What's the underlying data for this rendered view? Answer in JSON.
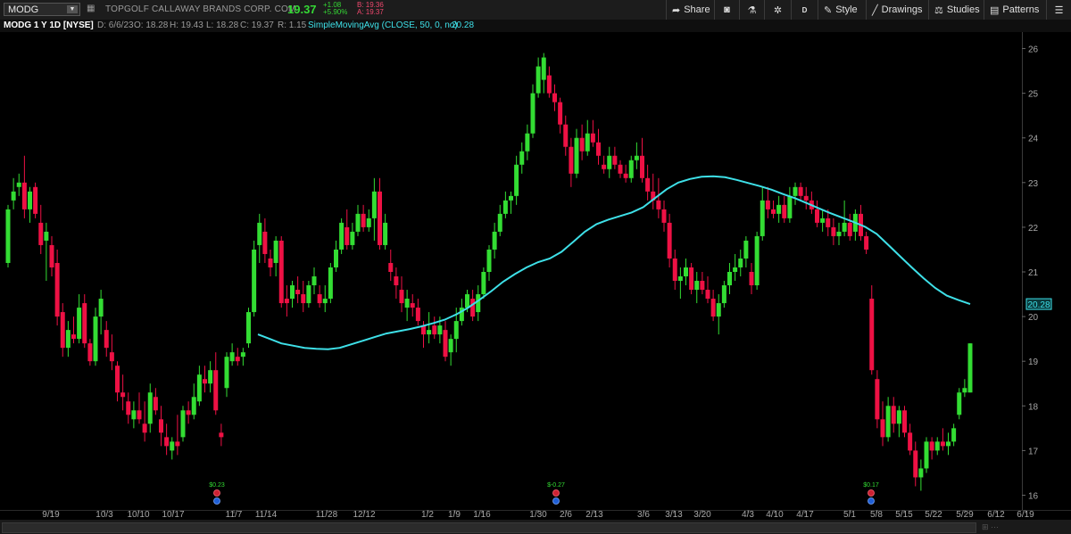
{
  "toolbar": {
    "symbol": "MODG",
    "company": "TOPGOLF CALLAWAY BRANDS CORP. COM",
    "last": "19.37",
    "change": "+1.08",
    "change_pct": "+5.90%",
    "bid": "B: 19.36",
    "ask": "A: 19.37",
    "share": "Share",
    "period_btn": "D",
    "style": "Style",
    "drawings": "Drawings",
    "studies": "Studies",
    "patterns": "Patterns"
  },
  "info": {
    "title": "MODG 1 Y 1D [NYSE]",
    "date": "D: 6/6/23",
    "open": "O: 18.28",
    "high": "H: 19.43",
    "low": "L: 18.28",
    "close": "C: 19.37",
    "range": "R: 1.15",
    "study": "SimpleMovingAvg (CLOSE, 50, 0, no)",
    "study_value": "20.28"
  },
  "colors": {
    "up": "#33dd33",
    "down": "#ee1144",
    "sma": "#3ee0e8",
    "bg": "#000000"
  },
  "chart_data": {
    "type": "candlestick",
    "y_ticks": [
      16,
      17,
      18,
      19,
      20,
      21,
      22,
      23,
      24,
      25,
      26
    ],
    "ylim": [
      15.7,
      26.7
    ],
    "x_ticks": [
      "9/19",
      "10/3",
      "10/10",
      "10/17",
      "11/7",
      "11/14",
      "11/28",
      "12/12",
      "1/2",
      "1/9",
      "1/16",
      "1/30",
      "2/6",
      "2/13",
      "3/6",
      "3/13",
      "3/20",
      "4/3",
      "4/10",
      "4/17",
      "5/1",
      "5/8",
      "5/15",
      "5/22",
      "5/29",
      "6/12",
      "6/19"
    ],
    "sma_label": "20.28",
    "earnings": [
      {
        "date": "11/3",
        "label": "$0.23"
      },
      {
        "date": "2/9",
        "label": "$-0.27"
      },
      {
        "date": "5/4",
        "label": "$0.17"
      }
    ],
    "candles": [
      {
        "o": 21.2,
        "h": 22.5,
        "l": 21.1,
        "c": 22.4
      },
      {
        "o": 22.6,
        "h": 23.1,
        "l": 22.4,
        "c": 22.8
      },
      {
        "o": 22.9,
        "h": 23.2,
        "l": 22.7,
        "c": 23.0
      },
      {
        "o": 23.0,
        "h": 23.6,
        "l": 22.2,
        "c": 22.4
      },
      {
        "o": 22.4,
        "h": 22.9,
        "l": 22.1,
        "c": 22.8
      },
      {
        "o": 22.9,
        "h": 23.0,
        "l": 22.2,
        "c": 22.3
      },
      {
        "o": 22.1,
        "h": 22.5,
        "l": 21.4,
        "c": 21.6
      },
      {
        "o": 21.7,
        "h": 22.1,
        "l": 20.8,
        "c": 21.9
      },
      {
        "o": 21.6,
        "h": 21.8,
        "l": 20.9,
        "c": 21.1
      },
      {
        "o": 21.2,
        "h": 21.5,
        "l": 19.8,
        "c": 20.0
      },
      {
        "o": 20.1,
        "h": 20.3,
        "l": 19.1,
        "c": 19.3
      },
      {
        "o": 19.3,
        "h": 19.9,
        "l": 19.1,
        "c": 19.7
      },
      {
        "o": 19.6,
        "h": 20.0,
        "l": 19.4,
        "c": 19.5
      },
      {
        "o": 19.5,
        "h": 20.5,
        "l": 19.4,
        "c": 20.2
      },
      {
        "o": 20.3,
        "h": 20.5,
        "l": 19.3,
        "c": 19.4
      },
      {
        "o": 19.4,
        "h": 19.5,
        "l": 18.9,
        "c": 19.0
      },
      {
        "o": 19.0,
        "h": 20.2,
        "l": 18.9,
        "c": 20.0
      },
      {
        "o": 20.0,
        "h": 20.6,
        "l": 19.6,
        "c": 20.4
      },
      {
        "o": 19.7,
        "h": 19.9,
        "l": 19.1,
        "c": 19.3
      },
      {
        "o": 19.2,
        "h": 19.6,
        "l": 18.8,
        "c": 19.0
      },
      {
        "o": 18.9,
        "h": 19.0,
        "l": 18.1,
        "c": 18.3
      },
      {
        "o": 18.3,
        "h": 18.7,
        "l": 17.9,
        "c": 18.2
      },
      {
        "o": 18.1,
        "h": 18.3,
        "l": 17.6,
        "c": 17.8
      },
      {
        "o": 17.7,
        "h": 18.1,
        "l": 17.5,
        "c": 17.9
      },
      {
        "o": 17.9,
        "h": 18.3,
        "l": 17.6,
        "c": 17.7
      },
      {
        "o": 17.6,
        "h": 18.1,
        "l": 17.2,
        "c": 17.4
      },
      {
        "o": 17.6,
        "h": 18.5,
        "l": 17.4,
        "c": 18.3
      },
      {
        "o": 18.2,
        "h": 18.4,
        "l": 17.8,
        "c": 17.9
      },
      {
        "o": 17.7,
        "h": 18.0,
        "l": 17.1,
        "c": 17.4
      },
      {
        "o": 17.3,
        "h": 17.6,
        "l": 16.9,
        "c": 17.1
      },
      {
        "o": 17.0,
        "h": 17.3,
        "l": 16.8,
        "c": 17.2
      },
      {
        "o": 17.2,
        "h": 17.8,
        "l": 16.9,
        "c": 17.1
      },
      {
        "o": 17.3,
        "h": 18.0,
        "l": 17.2,
        "c": 17.9
      },
      {
        "o": 17.9,
        "h": 18.1,
        "l": 17.6,
        "c": 17.8
      },
      {
        "o": 17.8,
        "h": 18.5,
        "l": 17.7,
        "c": 18.2
      },
      {
        "o": 18.1,
        "h": 18.9,
        "l": 18.0,
        "c": 18.7
      },
      {
        "o": 18.6,
        "h": 18.9,
        "l": 18.3,
        "c": 18.5
      },
      {
        "o": 18.5,
        "h": 19.0,
        "l": 18.3,
        "c": 18.8
      },
      {
        "o": 18.8,
        "h": 19.2,
        "l": 17.8,
        "c": 17.9
      },
      {
        "o": 17.4,
        "h": 17.6,
        "l": 17.1,
        "c": 17.3
      },
      {
        "o": 18.4,
        "h": 19.2,
        "l": 18.2,
        "c": 19.1
      },
      {
        "o": 19.0,
        "h": 19.4,
        "l": 18.9,
        "c": 19.2
      },
      {
        "o": 19.1,
        "h": 19.3,
        "l": 18.9,
        "c": 19.0
      },
      {
        "o": 19.1,
        "h": 19.3,
        "l": 18.9,
        "c": 19.2
      },
      {
        "o": 19.4,
        "h": 20.2,
        "l": 19.3,
        "c": 20.1
      },
      {
        "o": 20.1,
        "h": 21.7,
        "l": 20.0,
        "c": 21.5
      },
      {
        "o": 21.6,
        "h": 22.3,
        "l": 21.2,
        "c": 22.1
      },
      {
        "o": 21.9,
        "h": 22.2,
        "l": 21.2,
        "c": 21.4
      },
      {
        "o": 21.3,
        "h": 21.5,
        "l": 20.9,
        "c": 21.1
      },
      {
        "o": 21.2,
        "h": 21.8,
        "l": 20.9,
        "c": 21.7
      },
      {
        "o": 21.7,
        "h": 21.8,
        "l": 20.2,
        "c": 20.3
      },
      {
        "o": 20.4,
        "h": 20.7,
        "l": 20.0,
        "c": 20.3
      },
      {
        "o": 20.4,
        "h": 20.8,
        "l": 20.2,
        "c": 20.7
      },
      {
        "o": 20.6,
        "h": 20.9,
        "l": 20.3,
        "c": 20.5
      },
      {
        "o": 20.5,
        "h": 20.8,
        "l": 20.1,
        "c": 20.3
      },
      {
        "o": 20.3,
        "h": 20.8,
        "l": 20.2,
        "c": 20.7
      },
      {
        "o": 20.7,
        "h": 21.1,
        "l": 20.5,
        "c": 20.9
      },
      {
        "o": 20.5,
        "h": 20.7,
        "l": 20.2,
        "c": 20.3
      },
      {
        "o": 20.3,
        "h": 20.7,
        "l": 20.1,
        "c": 20.4
      },
      {
        "o": 20.4,
        "h": 21.2,
        "l": 20.3,
        "c": 21.1
      },
      {
        "o": 21.1,
        "h": 21.7,
        "l": 21.0,
        "c": 21.5
      },
      {
        "o": 21.5,
        "h": 22.2,
        "l": 21.4,
        "c": 22.1
      },
      {
        "o": 22.0,
        "h": 22.4,
        "l": 21.5,
        "c": 21.6
      },
      {
        "o": 21.6,
        "h": 22.1,
        "l": 21.5,
        "c": 21.9
      },
      {
        "o": 21.9,
        "h": 22.5,
        "l": 21.8,
        "c": 22.3
      },
      {
        "o": 22.3,
        "h": 22.5,
        "l": 21.9,
        "c": 22.0
      },
      {
        "o": 22.0,
        "h": 22.4,
        "l": 21.9,
        "c": 22.2
      },
      {
        "o": 22.2,
        "h": 23.1,
        "l": 21.7,
        "c": 22.8
      },
      {
        "o": 22.8,
        "h": 23.1,
        "l": 21.5,
        "c": 21.6
      },
      {
        "o": 21.6,
        "h": 22.3,
        "l": 21.5,
        "c": 22.1
      },
      {
        "o": 21.2,
        "h": 21.5,
        "l": 20.8,
        "c": 21.0
      },
      {
        "o": 20.9,
        "h": 21.1,
        "l": 20.4,
        "c": 20.7
      },
      {
        "o": 20.6,
        "h": 20.9,
        "l": 20.1,
        "c": 20.3
      },
      {
        "o": 20.2,
        "h": 20.6,
        "l": 19.9,
        "c": 20.4
      },
      {
        "o": 20.3,
        "h": 20.5,
        "l": 20.0,
        "c": 20.2
      },
      {
        "o": 20.2,
        "h": 20.4,
        "l": 19.8,
        "c": 19.9
      },
      {
        "o": 19.8,
        "h": 19.9,
        "l": 19.3,
        "c": 19.6
      },
      {
        "o": 19.6,
        "h": 20.1,
        "l": 19.4,
        "c": 19.7
      },
      {
        "o": 19.8,
        "h": 20.0,
        "l": 19.5,
        "c": 19.6
      },
      {
        "o": 19.6,
        "h": 20.0,
        "l": 19.4,
        "c": 19.8
      },
      {
        "o": 19.7,
        "h": 19.9,
        "l": 19.0,
        "c": 19.1
      },
      {
        "o": 19.2,
        "h": 19.6,
        "l": 18.9,
        "c": 19.5
      },
      {
        "o": 19.5,
        "h": 20.2,
        "l": 19.2,
        "c": 19.9
      },
      {
        "o": 19.9,
        "h": 20.4,
        "l": 19.8,
        "c": 20.2
      },
      {
        "o": 20.2,
        "h": 20.6,
        "l": 20.1,
        "c": 20.5
      },
      {
        "o": 20.4,
        "h": 20.6,
        "l": 19.9,
        "c": 20.0
      },
      {
        "o": 20.1,
        "h": 20.7,
        "l": 19.9,
        "c": 20.5
      },
      {
        "o": 20.5,
        "h": 21.1,
        "l": 20.4,
        "c": 21.0
      },
      {
        "o": 21.0,
        "h": 21.6,
        "l": 20.8,
        "c": 21.5
      },
      {
        "o": 21.5,
        "h": 22.1,
        "l": 21.3,
        "c": 21.9
      },
      {
        "o": 21.9,
        "h": 22.5,
        "l": 21.8,
        "c": 22.3
      },
      {
        "o": 22.3,
        "h": 22.8,
        "l": 22.2,
        "c": 22.6
      },
      {
        "o": 22.6,
        "h": 22.8,
        "l": 22.3,
        "c": 22.7
      },
      {
        "o": 22.7,
        "h": 23.6,
        "l": 22.5,
        "c": 23.4
      },
      {
        "o": 23.4,
        "h": 23.9,
        "l": 23.2,
        "c": 23.7
      },
      {
        "o": 23.7,
        "h": 24.3,
        "l": 23.5,
        "c": 24.1
      },
      {
        "o": 24.1,
        "h": 25.2,
        "l": 24.0,
        "c": 25.0
      },
      {
        "o": 25.0,
        "h": 25.8,
        "l": 24.9,
        "c": 25.6
      },
      {
        "o": 25.3,
        "h": 25.9,
        "l": 25.0,
        "c": 25.8
      },
      {
        "o": 25.4,
        "h": 25.6,
        "l": 24.9,
        "c": 25.0
      },
      {
        "o": 25.0,
        "h": 25.2,
        "l": 24.6,
        "c": 24.8
      },
      {
        "o": 24.8,
        "h": 24.9,
        "l": 24.1,
        "c": 24.3
      },
      {
        "o": 24.3,
        "h": 24.5,
        "l": 23.6,
        "c": 23.8
      },
      {
        "o": 23.8,
        "h": 24.0,
        "l": 22.9,
        "c": 23.2
      },
      {
        "o": 23.2,
        "h": 24.2,
        "l": 23.1,
        "c": 24.0
      },
      {
        "o": 24.0,
        "h": 24.3,
        "l": 23.5,
        "c": 23.7
      },
      {
        "o": 23.7,
        "h": 24.4,
        "l": 23.6,
        "c": 24.1
      },
      {
        "o": 24.1,
        "h": 24.4,
        "l": 23.8,
        "c": 23.9
      },
      {
        "o": 23.9,
        "h": 24.2,
        "l": 23.4,
        "c": 23.6
      },
      {
        "o": 23.4,
        "h": 23.6,
        "l": 23.2,
        "c": 23.3
      },
      {
        "o": 23.3,
        "h": 23.8,
        "l": 23.1,
        "c": 23.6
      },
      {
        "o": 23.6,
        "h": 23.8,
        "l": 23.3,
        "c": 23.4
      },
      {
        "o": 23.4,
        "h": 23.5,
        "l": 23.1,
        "c": 23.2
      },
      {
        "o": 23.2,
        "h": 23.4,
        "l": 23.0,
        "c": 23.1
      },
      {
        "o": 23.1,
        "h": 23.6,
        "l": 23.0,
        "c": 23.5
      },
      {
        "o": 23.5,
        "h": 23.9,
        "l": 23.3,
        "c": 23.6
      },
      {
        "o": 23.6,
        "h": 24.0,
        "l": 23.0,
        "c": 23.1
      },
      {
        "o": 23.1,
        "h": 23.4,
        "l": 22.6,
        "c": 22.8
      },
      {
        "o": 22.8,
        "h": 23.2,
        "l": 22.4,
        "c": 22.6
      },
      {
        "o": 22.6,
        "h": 23.1,
        "l": 22.2,
        "c": 22.4
      },
      {
        "o": 22.4,
        "h": 22.6,
        "l": 21.9,
        "c": 22.1
      },
      {
        "o": 22.1,
        "h": 22.3,
        "l": 21.1,
        "c": 21.3
      },
      {
        "o": 21.3,
        "h": 21.5,
        "l": 20.6,
        "c": 20.8
      },
      {
        "o": 20.8,
        "h": 21.1,
        "l": 20.4,
        "c": 20.9
      },
      {
        "o": 20.9,
        "h": 21.3,
        "l": 20.7,
        "c": 21.1
      },
      {
        "o": 21.1,
        "h": 21.2,
        "l": 20.5,
        "c": 20.6
      },
      {
        "o": 20.6,
        "h": 21.0,
        "l": 20.3,
        "c": 20.8
      },
      {
        "o": 20.8,
        "h": 21.0,
        "l": 20.5,
        "c": 20.6
      },
      {
        "o": 20.6,
        "h": 20.9,
        "l": 20.3,
        "c": 20.4
      },
      {
        "o": 20.4,
        "h": 20.6,
        "l": 19.9,
        "c": 20.0
      },
      {
        "o": 20.0,
        "h": 20.5,
        "l": 19.6,
        "c": 20.3
      },
      {
        "o": 20.3,
        "h": 20.8,
        "l": 20.2,
        "c": 20.7
      },
      {
        "o": 20.7,
        "h": 21.2,
        "l": 20.5,
        "c": 21.0
      },
      {
        "o": 21.0,
        "h": 21.4,
        "l": 20.8,
        "c": 21.1
      },
      {
        "o": 21.1,
        "h": 21.5,
        "l": 20.9,
        "c": 21.3
      },
      {
        "o": 21.3,
        "h": 21.8,
        "l": 21.1,
        "c": 21.7
      },
      {
        "o": 21.0,
        "h": 21.2,
        "l": 20.5,
        "c": 20.7
      },
      {
        "o": 20.7,
        "h": 21.9,
        "l": 20.6,
        "c": 21.8
      },
      {
        "o": 21.8,
        "h": 22.9,
        "l": 21.7,
        "c": 22.6
      },
      {
        "o": 22.6,
        "h": 22.9,
        "l": 22.2,
        "c": 22.4
      },
      {
        "o": 22.4,
        "h": 22.6,
        "l": 22.2,
        "c": 22.3
      },
      {
        "o": 22.3,
        "h": 22.7,
        "l": 22.1,
        "c": 22.5
      },
      {
        "o": 22.5,
        "h": 22.7,
        "l": 22.1,
        "c": 22.2
      },
      {
        "o": 22.2,
        "h": 22.9,
        "l": 22.1,
        "c": 22.7
      },
      {
        "o": 22.7,
        "h": 23.0,
        "l": 22.5,
        "c": 22.9
      },
      {
        "o": 22.9,
        "h": 23.0,
        "l": 22.6,
        "c": 22.7
      },
      {
        "o": 22.7,
        "h": 22.9,
        "l": 22.4,
        "c": 22.6
      },
      {
        "o": 22.6,
        "h": 22.8,
        "l": 22.3,
        "c": 22.4
      },
      {
        "o": 22.4,
        "h": 22.6,
        "l": 22.0,
        "c": 22.1
      },
      {
        "o": 22.1,
        "h": 22.4,
        "l": 21.9,
        "c": 22.2
      },
      {
        "o": 22.2,
        "h": 22.4,
        "l": 21.8,
        "c": 22.0
      },
      {
        "o": 22.0,
        "h": 22.2,
        "l": 21.6,
        "c": 21.8
      },
      {
        "o": 21.8,
        "h": 22.1,
        "l": 21.6,
        "c": 21.9
      },
      {
        "o": 21.9,
        "h": 22.6,
        "l": 21.8,
        "c": 22.1
      },
      {
        "o": 22.1,
        "h": 22.3,
        "l": 21.7,
        "c": 21.8
      },
      {
        "o": 21.9,
        "h": 22.4,
        "l": 21.7,
        "c": 22.3
      },
      {
        "o": 22.3,
        "h": 22.5,
        "l": 21.7,
        "c": 21.8
      },
      {
        "o": 21.8,
        "h": 21.9,
        "l": 21.4,
        "c": 21.5
      },
      {
        "o": 20.4,
        "h": 20.7,
        "l": 18.7,
        "c": 18.8
      },
      {
        "o": 18.6,
        "h": 18.8,
        "l": 17.5,
        "c": 17.7
      },
      {
        "o": 17.7,
        "h": 18.1,
        "l": 17.1,
        "c": 17.3
      },
      {
        "o": 17.3,
        "h": 18.2,
        "l": 17.2,
        "c": 18.0
      },
      {
        "o": 18.0,
        "h": 18.2,
        "l": 17.4,
        "c": 17.6
      },
      {
        "o": 17.6,
        "h": 18.0,
        "l": 17.3,
        "c": 17.9
      },
      {
        "o": 17.9,
        "h": 18.0,
        "l": 17.3,
        "c": 17.4
      },
      {
        "o": 17.4,
        "h": 17.6,
        "l": 16.9,
        "c": 17.0
      },
      {
        "o": 17.0,
        "h": 17.2,
        "l": 16.2,
        "c": 16.4
      },
      {
        "o": 16.4,
        "h": 16.8,
        "l": 16.1,
        "c": 16.6
      },
      {
        "o": 16.6,
        "h": 17.3,
        "l": 16.5,
        "c": 17.2
      },
      {
        "o": 17.2,
        "h": 17.3,
        "l": 16.8,
        "c": 17.0
      },
      {
        "o": 17.0,
        "h": 17.3,
        "l": 16.9,
        "c": 17.2
      },
      {
        "o": 17.2,
        "h": 17.5,
        "l": 17.0,
        "c": 17.1
      },
      {
        "o": 17.1,
        "h": 17.4,
        "l": 16.9,
        "c": 17.2
      },
      {
        "o": 17.2,
        "h": 17.6,
        "l": 17.1,
        "c": 17.5
      },
      {
        "o": 17.8,
        "h": 18.4,
        "l": 17.7,
        "c": 18.3
      },
      {
        "o": 18.3,
        "h": 18.6,
        "l": 18.2,
        "c": 18.4
      },
      {
        "o": 18.3,
        "h": 19.4,
        "l": 18.3,
        "c": 19.4
      }
    ],
    "sma_values": [
      19.6,
      19.5,
      19.4,
      19.35,
      19.3,
      19.28,
      19.27,
      19.3,
      19.38,
      19.46,
      19.54,
      19.62,
      19.67,
      19.72,
      19.78,
      19.85,
      19.93,
      20.05,
      20.2,
      20.38,
      20.57,
      20.78,
      20.95,
      21.1,
      21.22,
      21.3,
      21.45,
      21.67,
      21.9,
      22.07,
      22.17,
      22.25,
      22.33,
      22.45,
      22.65,
      22.85,
      23.0,
      23.08,
      23.13,
      23.14,
      23.12,
      23.06,
      22.99,
      22.92,
      22.84,
      22.74,
      22.65,
      22.54,
      22.43,
      22.32,
      22.22,
      22.12,
      22.01,
      21.85,
      21.6,
      21.35,
      21.1,
      20.86,
      20.64,
      20.47,
      20.37,
      20.28
    ]
  }
}
